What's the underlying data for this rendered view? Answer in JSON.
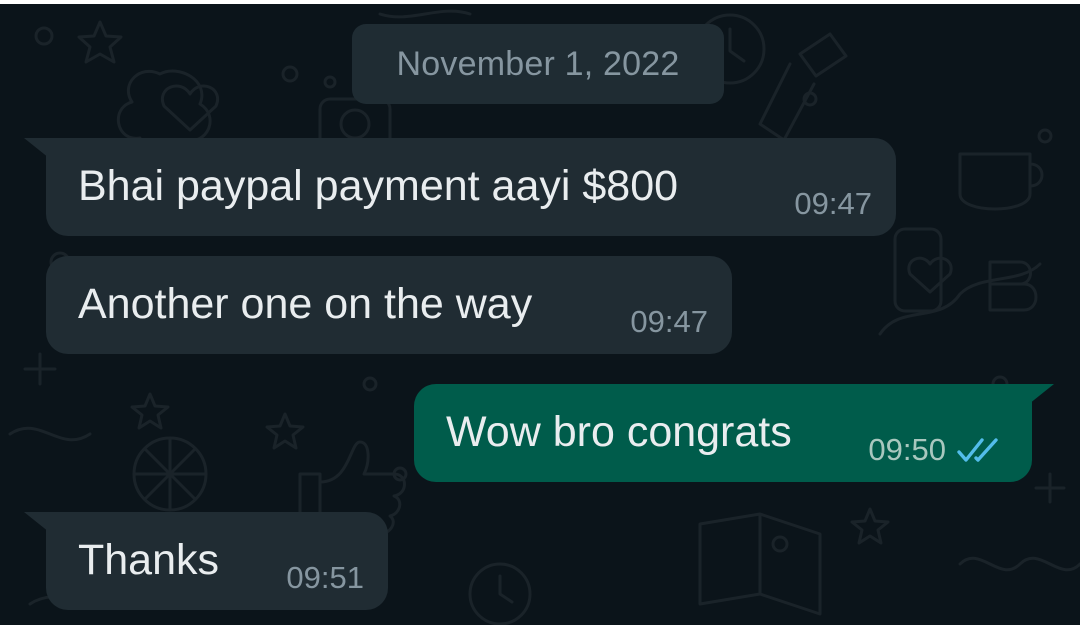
{
  "chat": {
    "date_label": "November 1, 2022",
    "messages": [
      {
        "direction": "incoming",
        "text": "Bhai paypal payment aayi $800",
        "time": "09:47"
      },
      {
        "direction": "incoming",
        "text": "Another one on the way",
        "time": "09:47"
      },
      {
        "direction": "outgoing",
        "text": "Wow bro congrats",
        "time": "09:50",
        "status": "read",
        "status_icon": "double-check-icon"
      },
      {
        "direction": "incoming",
        "text": "Thanks",
        "time": "09:51"
      }
    ]
  },
  "colors": {
    "background": "#0b141a",
    "incoming_bubble": "#202c33",
    "outgoing_bubble": "#005c4b",
    "text": "#e9edef",
    "meta_text": "#8696a0",
    "read_ticks": "#53bdeb"
  }
}
